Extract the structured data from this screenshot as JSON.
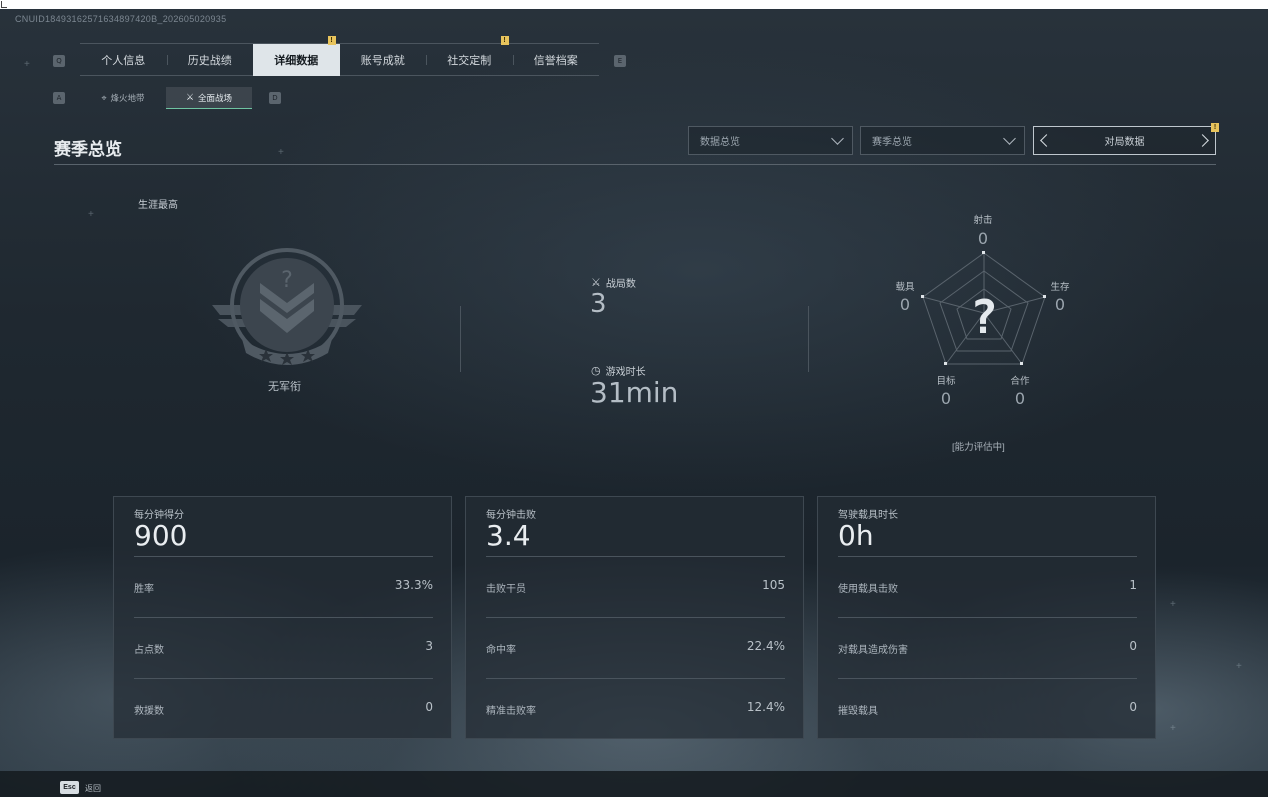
{
  "uid": "CNUID18493162571634897420B_202605020935",
  "header_ghost_title": "",
  "hotkeys": {
    "tabs_left": "Q",
    "tabs_right": "E",
    "sub_left": "A",
    "sub_right": "D"
  },
  "tabs": [
    {
      "label": "个人信息",
      "badge": ""
    },
    {
      "label": "历史战绩",
      "badge": ""
    },
    {
      "label": "详细数据",
      "badge": "!"
    },
    {
      "label": "账号成就",
      "badge": ""
    },
    {
      "label": "社交定制",
      "badge": "!"
    },
    {
      "label": "信誉档案",
      "badge": ""
    }
  ],
  "active_tab": "详细数据",
  "subtabs": [
    {
      "label": "烽火地带",
      "icon": "crosshair-icon"
    },
    {
      "label": "全面战场",
      "icon": "target-icon"
    }
  ],
  "active_subtab": "全面战场",
  "section_title": "赛季总览",
  "filters": {
    "data_dropdown": "数据总览",
    "season_dropdown": "赛季总览",
    "mode_switcher": "对局数据",
    "mode_badge": "!"
  },
  "career": {
    "label": "生涯最高",
    "rank_name": "无军衔",
    "rank_glyph": "?"
  },
  "summary": {
    "matches_label": "战局数",
    "matches_value": "3",
    "playtime_label": "游戏时长",
    "playtime_value": "31min"
  },
  "radar": {
    "center_glyph": "?",
    "axes": [
      {
        "label": "射击",
        "value": "0"
      },
      {
        "label": "生存",
        "value": "0"
      },
      {
        "label": "合作",
        "value": "0"
      },
      {
        "label": "目标",
        "value": "0"
      },
      {
        "label": "载具",
        "value": "0"
      }
    ],
    "note": "[能力评估中]"
  },
  "cards": [
    {
      "head_label": "每分钟得分",
      "head_value": "900",
      "rows": [
        {
          "label": "胜率",
          "value": "33.3%"
        },
        {
          "label": "占点数",
          "value": "3"
        },
        {
          "label": "救援数",
          "value": "0"
        }
      ]
    },
    {
      "head_label": "每分钟击败",
      "head_value": "3.4",
      "rows": [
        {
          "label": "击败干员",
          "value": "105"
        },
        {
          "label": "命中率",
          "value": "22.4%"
        },
        {
          "label": "精准击败率",
          "value": "12.4%"
        }
      ]
    },
    {
      "head_label": "驾驶载具时长",
      "head_value": "0h",
      "rows": [
        {
          "label": "使用载具击败",
          "value": "1"
        },
        {
          "label": "对载具造成伤害",
          "value": "0"
        },
        {
          "label": "摧毁载具",
          "value": "0"
        }
      ]
    }
  ],
  "footer": {
    "esc_key": "Esc",
    "esc_label": "返回"
  },
  "colors": {
    "accent": "#6fc4a2",
    "badge": "#e8c45c",
    "active_tab_bg": "#dfe5e9"
  }
}
